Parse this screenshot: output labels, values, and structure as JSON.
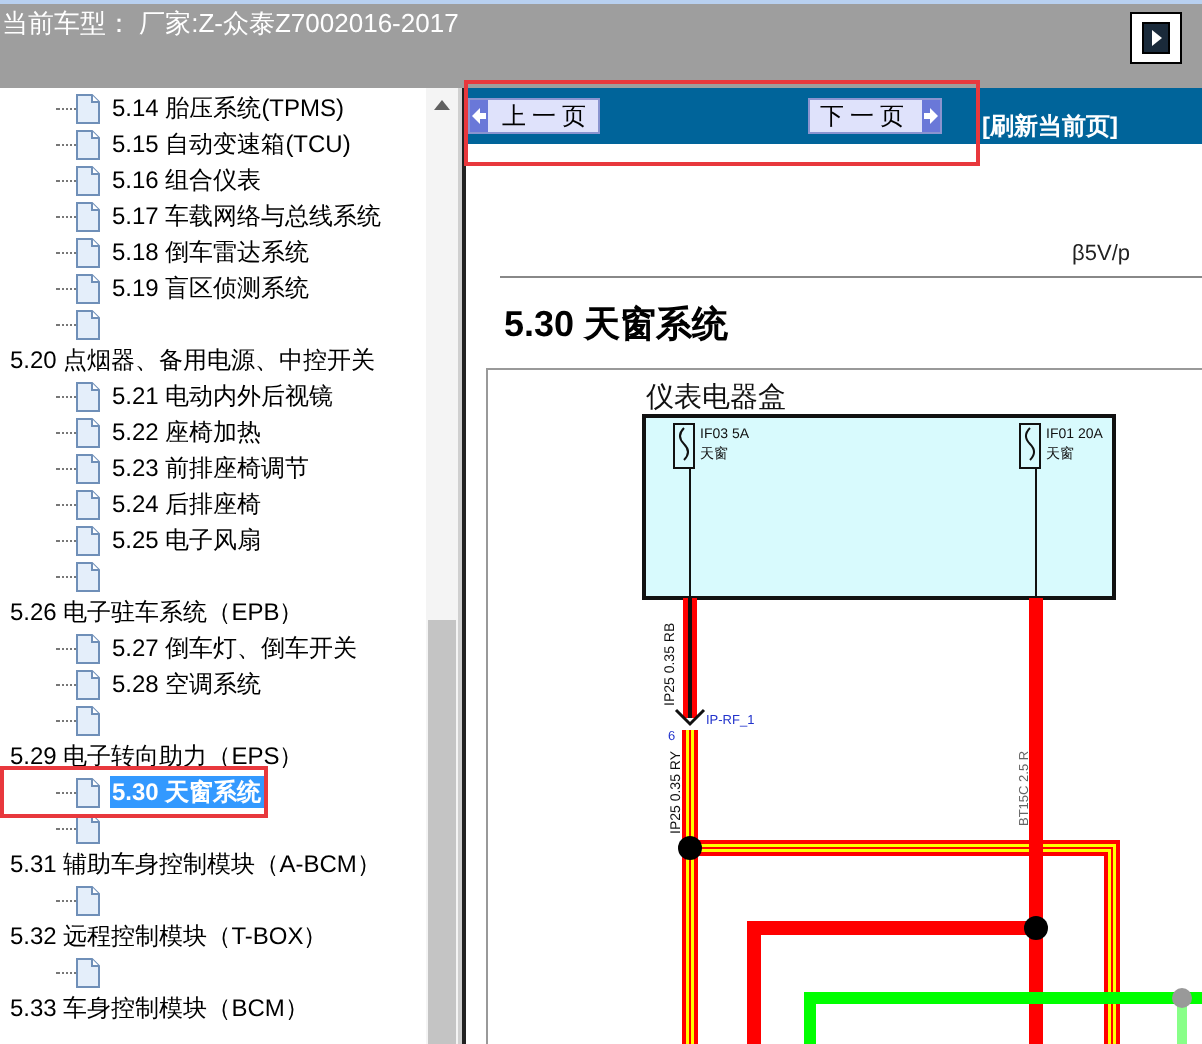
{
  "header": {
    "title": "当前车型： 厂家:Z-众泰Z7002016-2017"
  },
  "tree": {
    "items": [
      {
        "children": [
          {
            "label": "5.14 胎压系统(TPMS)",
            "selected": false
          },
          {
            "label": "5.15 自动变速箱(TCU)",
            "selected": false
          },
          {
            "label": "5.16 组合仪表",
            "selected": false
          },
          {
            "label": "5.17 车载网络与总线系统",
            "selected": false
          },
          {
            "label": "5.18 倒车雷达系统",
            "selected": false
          },
          {
            "label": "5.19 盲区侦测系统",
            "selected": false
          },
          {
            "selected": false
          }
        ]
      },
      {
        "label": "5.20 点烟器、备用电源、中控开关",
        "children": [
          {
            "label": "5.21 电动内外后视镜",
            "selected": false
          },
          {
            "label": "5.22 座椅加热",
            "selected": false
          },
          {
            "label": "5.23 前排座椅调节",
            "selected": false
          },
          {
            "label": "5.24 后排座椅",
            "selected": false
          },
          {
            "label": "5.25 电子风扇",
            "selected": false
          },
          {
            "selected": false
          }
        ]
      },
      {
        "label": "5.26 电子驻车系统（EPB）",
        "children": [
          {
            "label": "5.27 倒车灯、倒车开关",
            "selected": false
          },
          {
            "label": "5.28 空调系统",
            "selected": false
          },
          {
            "selected": false
          }
        ]
      },
      {
        "label": "5.29 电子转向助力（EPS）",
        "children": [
          {
            "label": "5.30 天窗系统",
            "selected": true
          },
          {
            "selected": false
          }
        ]
      },
      {
        "label": "5.31 辅助车身控制模块（A-BCM）",
        "children": [
          {
            "selected": false
          }
        ]
      },
      {
        "label": "5.32 远程控制模块（T-BOX）",
        "children": [
          {
            "selected": false
          }
        ]
      },
      {
        "label": "5.33 车身控制模块（BCM）"
      }
    ]
  },
  "viewer": {
    "nav": {
      "prev": "上一页",
      "next": "下一页",
      "refresh": "[刷新当前页]"
    },
    "page": {
      "header_note": "β5V/p",
      "title": "5.30 天窗系统",
      "diagram": {
        "box_label": "仪表电器盒",
        "fuses": [
          {
            "label": "IF03 5A",
            "sub": "天窗"
          },
          {
            "label": "IF01 20A",
            "sub": "天窗"
          }
        ],
        "wire_labels": [
          "IP25 0.35 RB",
          "IP25 0.35 RY",
          "BT15C 2.5 R"
        ],
        "connector": {
          "name": "IP-RF_1",
          "pin": "6"
        }
      }
    }
  }
}
